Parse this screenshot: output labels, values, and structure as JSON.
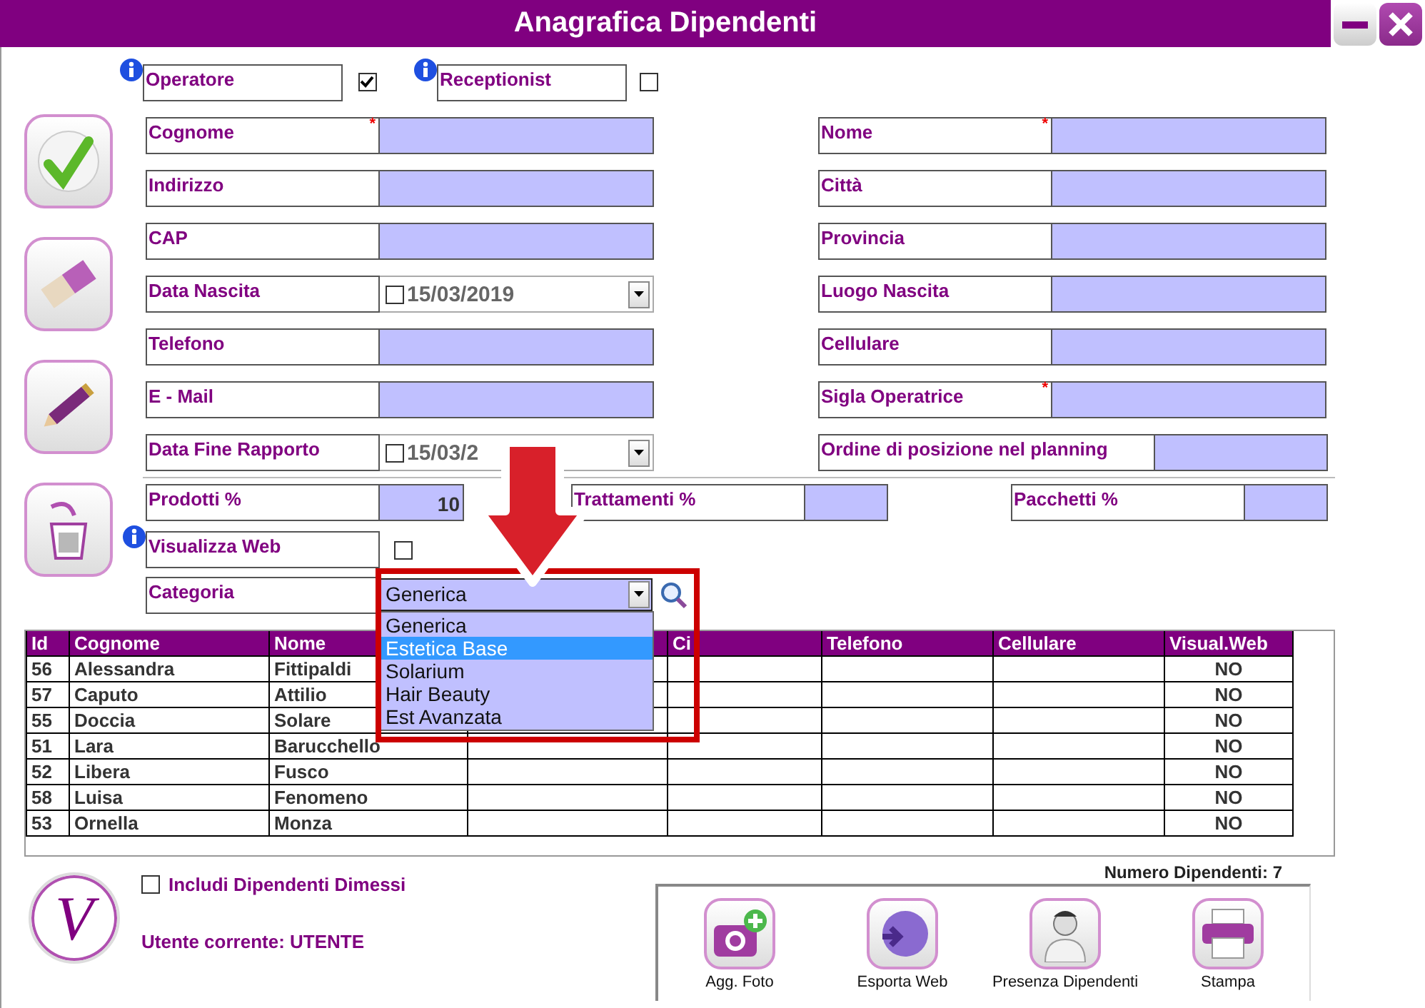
{
  "window": {
    "title": "Anagrafica Dipendenti"
  },
  "flags": [
    {
      "label": "Operatore",
      "checked": true
    },
    {
      "label": "Receptionist",
      "checked": false
    }
  ],
  "fields_left": [
    {
      "label": "Cognome",
      "mark": "*",
      "kind": "text"
    },
    {
      "label": "Indirizzo",
      "kind": "text"
    },
    {
      "label": "CAP",
      "kind": "text"
    },
    {
      "label": "Data Nascita",
      "kind": "date",
      "value": "15/03/2019",
      "checked": false
    },
    {
      "label": "Telefono",
      "kind": "text"
    },
    {
      "label": "E - Mail",
      "kind": "text"
    },
    {
      "label": "Data Fine Rapporto",
      "kind": "date",
      "value": "15/03/2",
      "checked": false
    }
  ],
  "fields_right": [
    {
      "label": "Nome",
      "mark": "*",
      "kind": "text"
    },
    {
      "label": "Città",
      "kind": "text"
    },
    {
      "label": "Provincia",
      "kind": "text"
    },
    {
      "label": "Luogo Nascita",
      "kind": "text"
    },
    {
      "label": "Cellulare",
      "kind": "text"
    },
    {
      "label": "Sigla Operatrice",
      "mark": "*",
      "kind": "text"
    },
    {
      "label": "Ordine di posizione nel planning",
      "kind": "wide"
    }
  ],
  "percentages": [
    {
      "label": "Prodotti %",
      "value": "10"
    },
    {
      "label": "Trattamenti %"
    },
    {
      "label": "Pacchetti %"
    }
  ],
  "web": {
    "label": "Visualizza Web",
    "checked": false
  },
  "category": {
    "label": "Categoria",
    "value": "Generica",
    "expanded": true,
    "options": [
      {
        "label": "Generica",
        "highlighted": false
      },
      {
        "label": "Estetica Base",
        "highlighted": true
      },
      {
        "label": "Solarium",
        "highlighted": false
      },
      {
        "label": "Hair Beauty",
        "highlighted": false
      },
      {
        "label": "Est Avanzata",
        "highlighted": false
      }
    ]
  },
  "table": {
    "columns": [
      {
        "label": "Id"
      },
      {
        "label": "Cognome"
      },
      {
        "label": "Nome"
      },
      {},
      {
        "label": "Ci"
      },
      {
        "label": "Telefono"
      },
      {
        "label": "Cellulare"
      },
      {
        "label": "Visual.Web"
      }
    ],
    "rows": [
      {
        "id": "56",
        "cognome": "Alessandra",
        "nome": "Fittipaldi",
        "visual_web": "NO"
      },
      {
        "id": "57",
        "cognome": "Caputo",
        "nome": "Attilio",
        "visual_web": "NO"
      },
      {
        "id": "55",
        "cognome": "Doccia",
        "nome": "Solare",
        "visual_web": "NO"
      },
      {
        "id": "51",
        "cognome": "Lara",
        "nome": "Barucchello",
        "visual_web": "NO"
      },
      {
        "id": "52",
        "cognome": "Libera",
        "nome": "Fusco",
        "visual_web": "NO"
      },
      {
        "id": "58",
        "cognome": "Luisa",
        "nome": "Fenomeno",
        "visual_web": "NO"
      },
      {
        "id": "53",
        "cognome": "Ornella",
        "nome": "Monza",
        "visual_web": "NO"
      }
    ]
  },
  "logo": {
    "letter": "V"
  },
  "include_dismissed": {
    "label": "Includi Dipendenti Dimessi",
    "checked": false
  },
  "current_user": "Utente corrente: UTENTE",
  "count": "Numero Dipendenti: 7",
  "toolbar": [
    {
      "label": "Agg. Foto",
      "kind": "photo"
    },
    {
      "label": "Esporta Web",
      "kind": "web"
    },
    {
      "label": "Presenza Dipendenti",
      "kind": "staff"
    },
    {
      "label": "Stampa",
      "kind": "print"
    }
  ]
}
